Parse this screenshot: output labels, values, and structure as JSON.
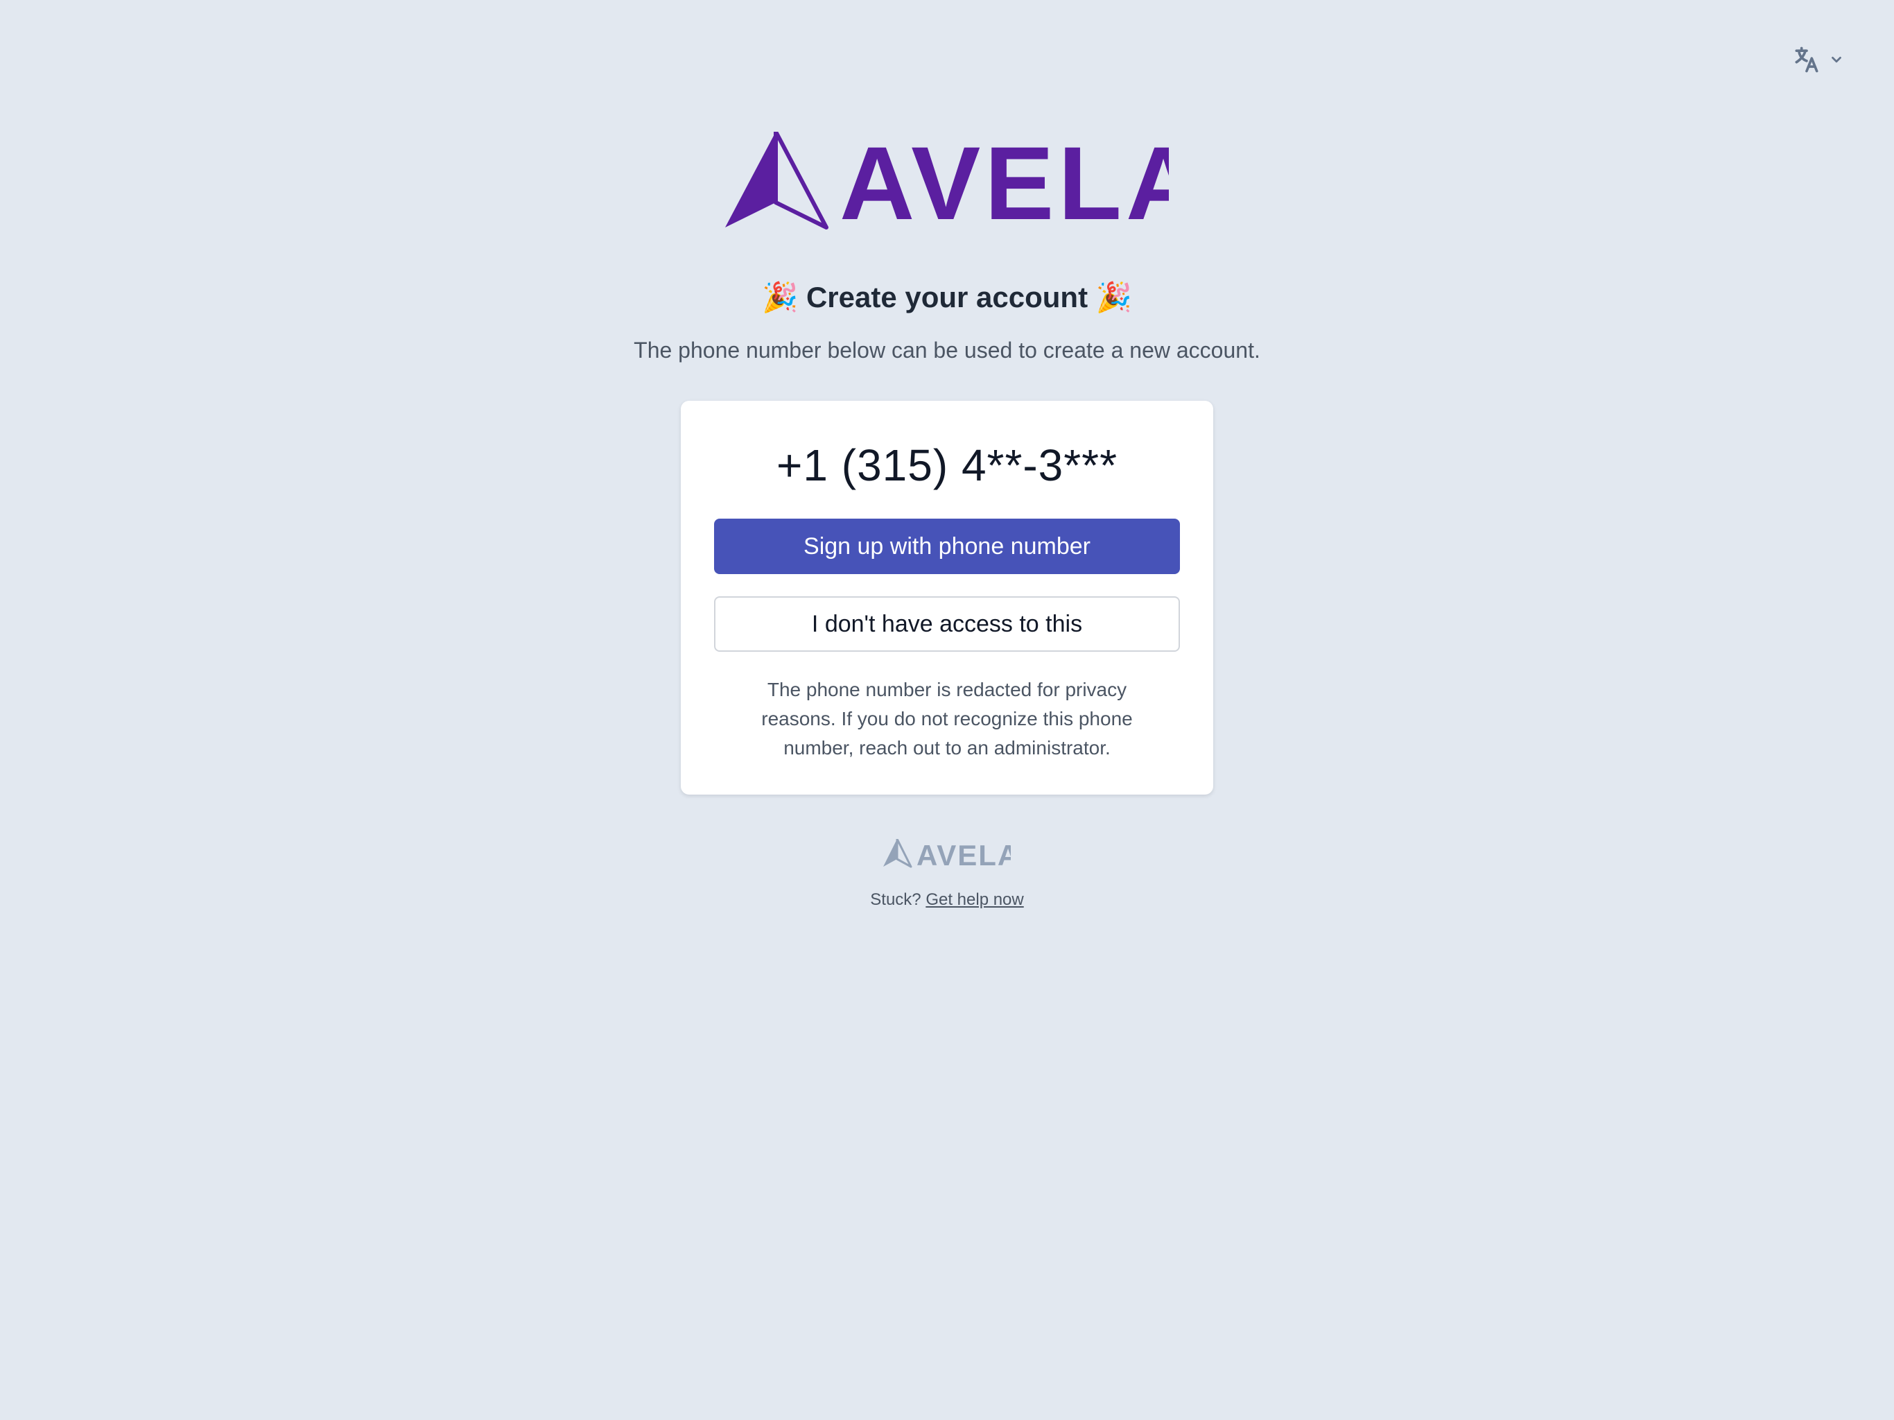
{
  "brand": {
    "name": "AVELA",
    "color": "#5b1fa0",
    "footer_color": "#94a3b8"
  },
  "language_switcher": {
    "icon": "translate-icon",
    "chevron": "chevron-down-icon"
  },
  "heading": {
    "emoji": "🎉",
    "title": "Create your account"
  },
  "subheading": "The phone number below can be used to create a new account.",
  "card": {
    "phone_number": "+1 (315) 4**-3***",
    "primary_button": "Sign up with phone number",
    "secondary_button": "I don't have access to this",
    "note": "The phone number is redacted for privacy reasons. If you do not recognize this phone number, reach out to an administrator."
  },
  "footer": {
    "help_prefix": "Stuck?",
    "help_link": "Get help now"
  },
  "colors": {
    "background": "#e2e8f0",
    "primary_button": "#4753b8"
  }
}
